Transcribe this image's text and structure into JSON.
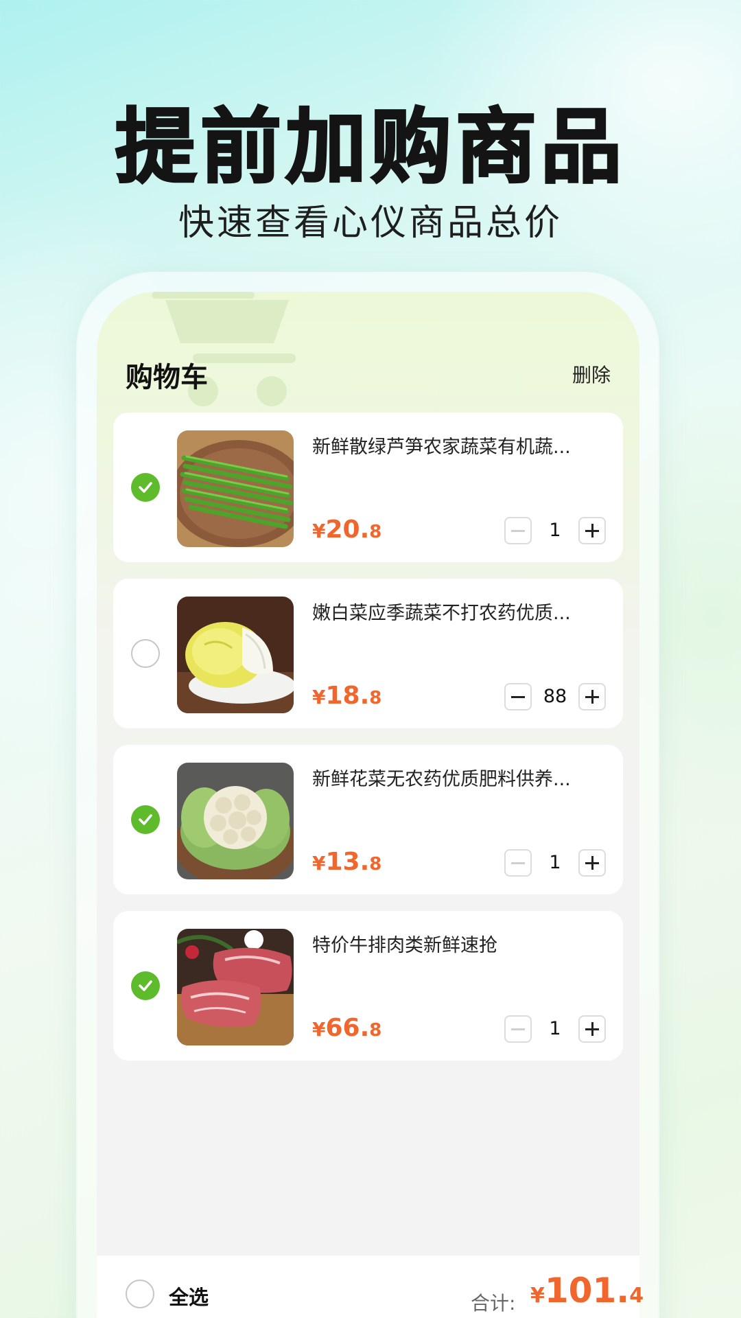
{
  "promo": {
    "headline": "提前加购商品",
    "subline": "快速查看心仪商品总价"
  },
  "cart": {
    "title": "购物车",
    "delete_label": "删除",
    "items": [
      {
        "name": "新鲜散绿芦笋农家蔬菜有机蔬...",
        "currency": "¥",
        "price_int": "20.",
        "price_dec": "8",
        "qty": "1",
        "checked": true,
        "minus_disabled": true,
        "image": "asparagus"
      },
      {
        "name": "嫩白菜应季蔬菜不打农药优质...",
        "currency": "¥",
        "price_int": "18.",
        "price_dec": "8",
        "qty": "88",
        "checked": false,
        "minus_disabled": false,
        "image": "napa-cabbage"
      },
      {
        "name": "新鲜花菜无农药优质肥料供养...",
        "currency": "¥",
        "price_int": "13.",
        "price_dec": "8",
        "qty": "1",
        "checked": true,
        "minus_disabled": true,
        "image": "cauliflower"
      },
      {
        "name": "特价牛排肉类新鲜速抢",
        "currency": "¥",
        "price_int": "66.",
        "price_dec": "8",
        "qty": "1",
        "checked": true,
        "minus_disabled": true,
        "image": "steak"
      }
    ]
  },
  "footer": {
    "select_all_label": "全选",
    "total_label": "合计:",
    "total_currency": "¥",
    "total_int": "101.",
    "total_dec": "4"
  },
  "colors": {
    "accent_green": "#5dbb2c",
    "price_orange": "#f0662c"
  }
}
